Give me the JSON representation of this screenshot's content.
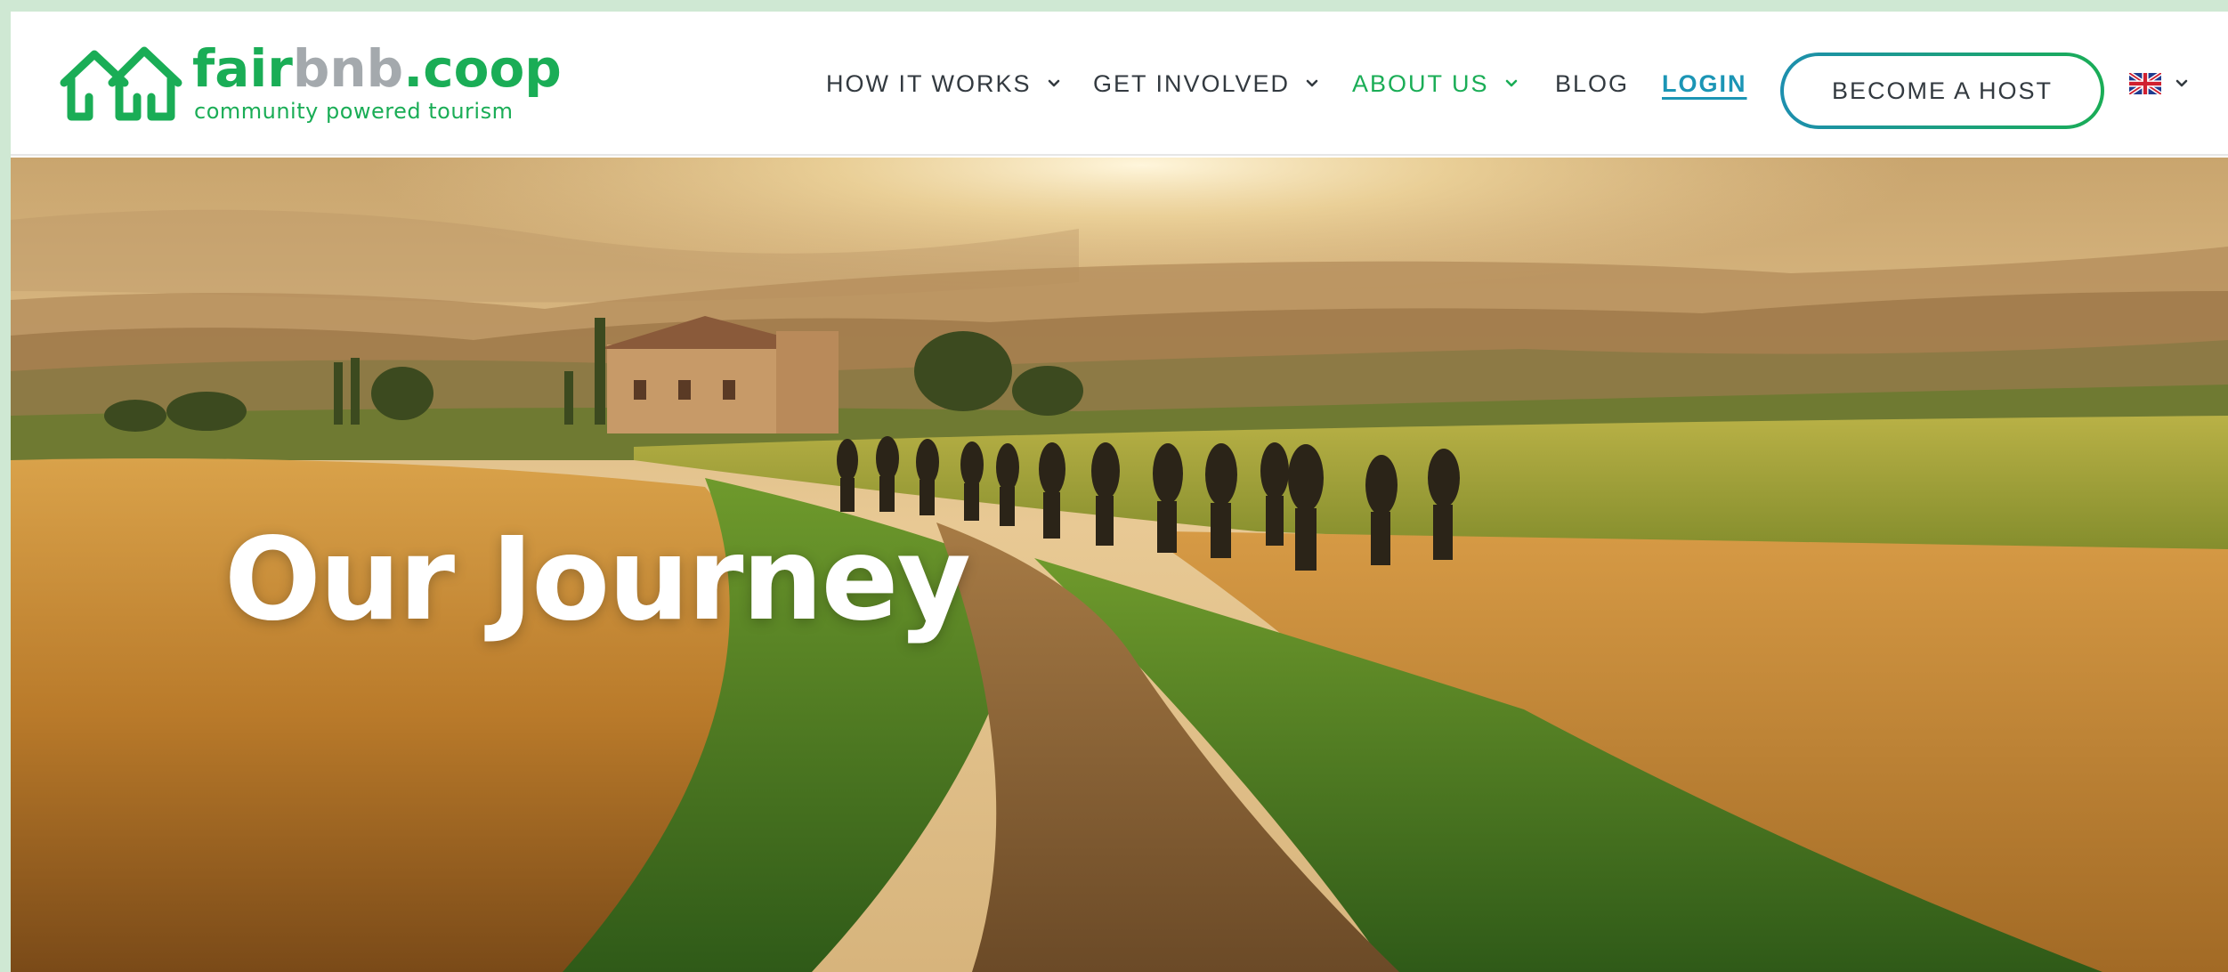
{
  "brand": {
    "name_part1": "fair",
    "name_part2": "bnb",
    "name_part3": ".coop",
    "tagline": "community powered tourism"
  },
  "nav": {
    "items": [
      {
        "label": "HOW IT WORKS",
        "has_dropdown": true
      },
      {
        "label": "GET INVOLVED",
        "has_dropdown": true
      },
      {
        "label": "ABOUT US",
        "has_dropdown": true,
        "active": true
      },
      {
        "label": "BLOG",
        "has_dropdown": false
      },
      {
        "label": "LOGIN",
        "has_dropdown": false
      }
    ],
    "cta_label": "BECOME A HOST",
    "language_icon": "uk-flag-icon"
  },
  "hero": {
    "title": "Our Journey"
  },
  "colors": {
    "brand_green": "#1aad56",
    "brand_grey": "#a4a9ad",
    "link_teal": "#1b95b5",
    "page_border": "#cfe8d3"
  }
}
